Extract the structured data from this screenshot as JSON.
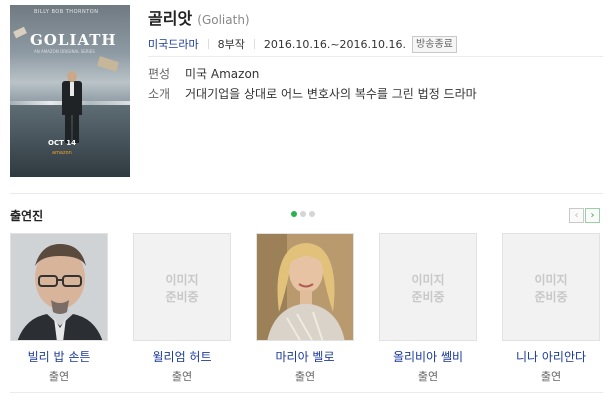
{
  "poster": {
    "tagline": "BILLY BOB THORNTON",
    "title": "GOLIATH",
    "subtitle": "AN AMAZON ORIGINAL SERIES",
    "date": "OCT 14",
    "brand": "amazon"
  },
  "drama": {
    "title": "골리앗",
    "original_title": "(Goliath)",
    "genre": "미국드라마",
    "episodes": "8부작",
    "period": "2016.10.16.~2016.10.16.",
    "status": "방송종료",
    "info": [
      {
        "label": "편성",
        "value": "미국 Amazon"
      },
      {
        "label": "소개",
        "value": "거대기업을 상대로 어느 변호사의 복수를 그린 법정 드라마"
      }
    ]
  },
  "cast": {
    "section_title": "출연진",
    "placeholder": [
      "이미지",
      "준비중"
    ],
    "prev_label": "‹",
    "next_label": "›",
    "items": [
      {
        "name": "빌리 밥 손튼",
        "role": "출연",
        "photo": "male"
      },
      {
        "name": "윌리엄 허트",
        "role": "출연",
        "photo": "none"
      },
      {
        "name": "마리아 벨로",
        "role": "출연",
        "photo": "female"
      },
      {
        "name": "올리비아 쎌비",
        "role": "출연",
        "photo": "none"
      },
      {
        "name": "니나 아리안다",
        "role": "출연",
        "photo": "none"
      }
    ]
  },
  "colors": {
    "link": "#1b3a9a",
    "accent": "#2ab24b"
  }
}
